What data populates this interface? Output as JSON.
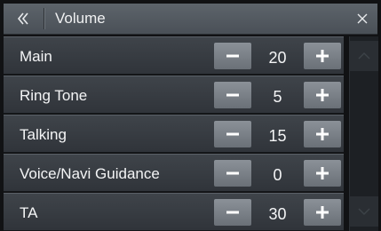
{
  "header": {
    "title": "Volume",
    "back_icon": "double-chevron-left-icon",
    "close_icon": "close-icon"
  },
  "volume_settings": [
    {
      "label": "Main",
      "value": "20"
    },
    {
      "label": "Ring Tone",
      "value": "5"
    },
    {
      "label": "Talking",
      "value": "15"
    },
    {
      "label": "Voice/Navi Guidance",
      "value": "0"
    },
    {
      "label": "TA",
      "value": "30"
    }
  ],
  "scrollbar": {
    "up_icon": "chevron-up-icon",
    "down_icon": "chevron-down-icon"
  },
  "colors": {
    "background": "#111214",
    "title_bar": "#5d646b",
    "row": "#3f444a",
    "button": "#7a8087",
    "text": "#f4f5f6"
  }
}
